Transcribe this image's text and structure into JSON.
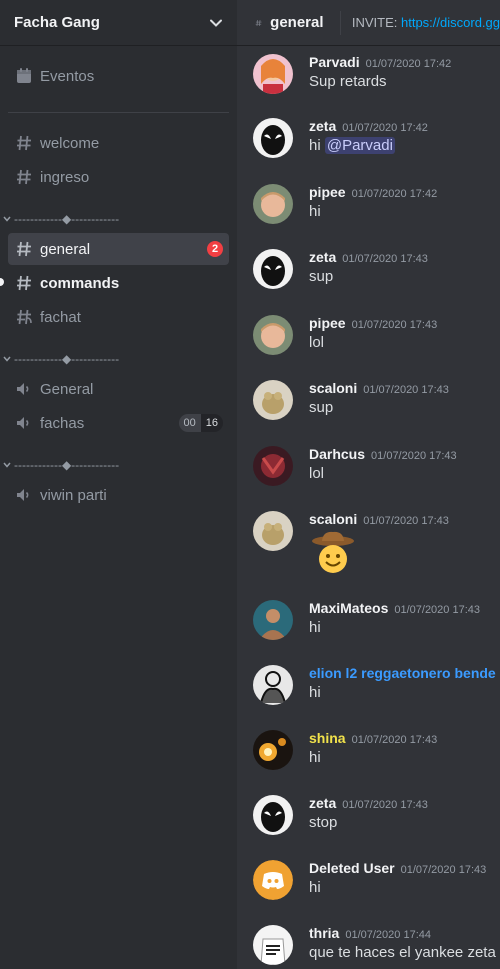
{
  "server": {
    "name": "Facha Gang"
  },
  "channels_top": [
    {
      "label": "Eventos",
      "type": "events"
    },
    {
      "label": "welcome",
      "type": "text"
    },
    {
      "label": "ingreso",
      "type": "text"
    }
  ],
  "categories": [
    {
      "label": "------------◆------------",
      "channels": [
        {
          "label": "general",
          "type": "text",
          "active": true,
          "badge": "2"
        },
        {
          "label": "commands",
          "type": "text",
          "unread": true
        },
        {
          "label": "fachat",
          "type": "text-thread"
        }
      ]
    },
    {
      "label": "------------◆------------",
      "channels": [
        {
          "label": "General",
          "type": "voice"
        },
        {
          "label": "fachas",
          "type": "voice",
          "count_a": "00",
          "count_b": "16"
        }
      ]
    },
    {
      "label": "------------◆------------",
      "channels": [
        {
          "label": "viwin parti",
          "type": "voice"
        }
      ]
    }
  ],
  "topbar": {
    "channel": "general",
    "topic_prefix": "INVITE:",
    "topic_link": "https://discord.gg"
  },
  "colors": {
    "accent": "#5865f2",
    "link": "#00a8fc",
    "badge": "#f23f43",
    "role_blue": "#3b9bff",
    "role_yellow": "#f1e24b"
  },
  "messages": [
    {
      "author": "Parvadi",
      "timestamp": "01/07/2020 17:42",
      "text": "Sup retards",
      "avatar": "anime-girl"
    },
    {
      "author": "zeta",
      "timestamp": "01/07/2020 17:42",
      "text": "hi",
      "mention": "@Parvadi",
      "avatar": "venom"
    },
    {
      "author": "pipee",
      "timestamp": "01/07/2020 17:42",
      "text": "hi",
      "avatar": "kid"
    },
    {
      "author": "zeta",
      "timestamp": "01/07/2020 17:43",
      "text": "sup",
      "avatar": "venom"
    },
    {
      "author": "pipee",
      "timestamp": "01/07/2020 17:43",
      "text": "lol",
      "avatar": "kid"
    },
    {
      "author": "scaloni",
      "timestamp": "01/07/2020 17:43",
      "text": "sup",
      "avatar": "frog"
    },
    {
      "author": "Darhcus",
      "timestamp": "01/07/2020 17:43",
      "text": "lol",
      "avatar": "demon"
    },
    {
      "author": "scaloni",
      "timestamp": "01/07/2020 17:43",
      "text": "",
      "emoji": "cowboy-emoji",
      "avatar": "frog"
    },
    {
      "author": "MaxiMateos",
      "timestamp": "01/07/2020 17:43",
      "text": "hi",
      "avatar": "painting"
    },
    {
      "author": "elion l2 reggaetonero bende",
      "timestamp": "",
      "text": "hi",
      "avatar": "sketch",
      "color": "blue"
    },
    {
      "author": "shina",
      "timestamp": "01/07/2020 17:43",
      "text": "hi",
      "avatar": "lamp",
      "color": "yellow"
    },
    {
      "author": "zeta",
      "timestamp": "01/07/2020 17:43",
      "text": "stop",
      "avatar": "venom"
    },
    {
      "author": "Deleted User",
      "timestamp": "01/07/2020 17:43",
      "text": "hi",
      "avatar": "discord-logo"
    },
    {
      "author": "thria",
      "timestamp": "01/07/2020 17:44",
      "text": "que te haces el yankee zeta",
      "avatar": "shirt"
    }
  ]
}
